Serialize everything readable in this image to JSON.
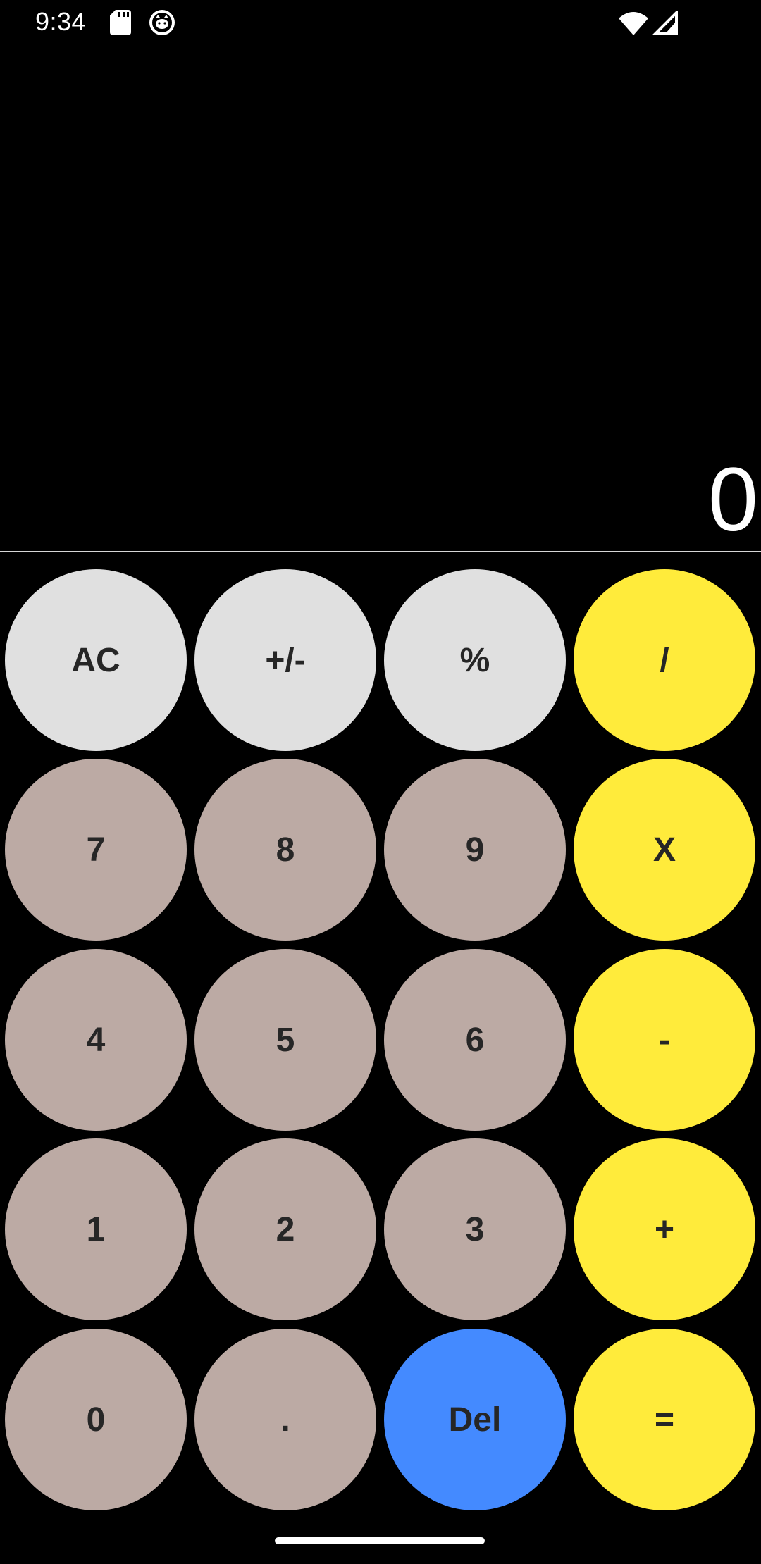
{
  "status_bar": {
    "time": "9:34",
    "icons": [
      "sd-card-icon",
      "cat-face-icon",
      "wifi-icon",
      "cell-signal-icon"
    ]
  },
  "display": {
    "value": "0"
  },
  "keys": {
    "ac": "AC",
    "sign": "+/-",
    "percent": "%",
    "divide": "/",
    "seven": "7",
    "eight": "8",
    "nine": "9",
    "multiply": "X",
    "four": "4",
    "five": "5",
    "six": "6",
    "minus": "-",
    "one": "1",
    "two": "2",
    "three": "3",
    "plus": "+",
    "zero": "0",
    "dot": ".",
    "del": "Del",
    "equals": "="
  },
  "colors": {
    "background": "#000000",
    "function_key": "#e0e0e0",
    "number_key": "#bcaaa4",
    "operator_key": "#ffeb3b",
    "delete_key": "#448aff",
    "key_text": "#262626",
    "display_text": "#ffffff"
  }
}
